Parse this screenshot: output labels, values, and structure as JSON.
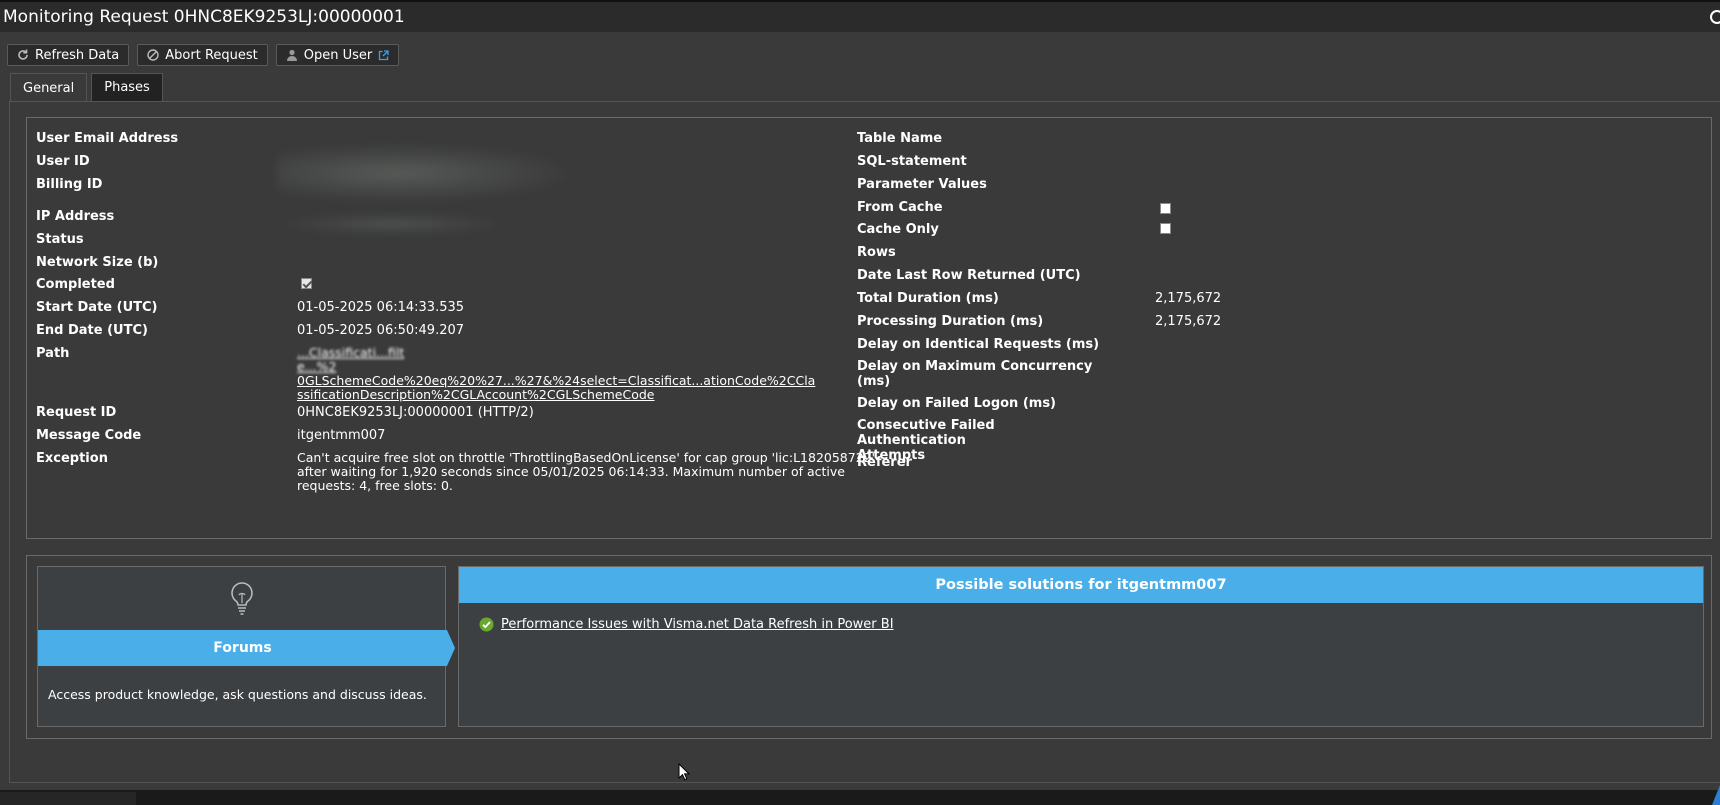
{
  "window": {
    "title": "Monitoring Request 0HNC8EK9253LJ:00000001"
  },
  "toolbar": {
    "refresh_label": "Refresh Data",
    "abort_label": "Abort Request",
    "open_user_label": "Open User"
  },
  "tabs": [
    {
      "label": "General",
      "active": true
    },
    {
      "label": "Phases",
      "active": false
    }
  ],
  "left_fields": {
    "user_email": {
      "label": "User Email Address",
      "value": ""
    },
    "user_id": {
      "label": "User ID",
      "value": ""
    },
    "billing_id": {
      "label": "Billing ID",
      "value": ""
    },
    "ip_address": {
      "label": "IP Address",
      "value": ""
    },
    "status": {
      "label": "Status",
      "value": ""
    },
    "network_size": {
      "label": "Network Size (b)",
      "value": ""
    },
    "completed": {
      "label": "Completed",
      "checked": true
    },
    "start_date": {
      "label": "Start Date (UTC)",
      "value": "01-05-2025 06:14:33.535"
    },
    "end_date": {
      "label": "End Date (UTC)",
      "value": "01-05-2025 06:50:49.207"
    },
    "path": {
      "label": "Path",
      "value_line1": "...Classificati...filt",
      "value_line2": "e...%2",
      "value_line3": "0GLSchemeCode%20eq%20%27...%27&%24select=Classificat...ationCode%2CCla",
      "value_line4": "ssificationDescription%2CGLAccount%2CGLSchemeCode"
    },
    "request_id": {
      "label": "Request ID",
      "value": "0HNC8EK9253LJ:00000001 (HTTP/2)"
    },
    "message_code": {
      "label": "Message Code",
      "value": "itgentmm007"
    },
    "exception": {
      "label": "Exception",
      "line1": "Can't acquire free slot on throttle 'ThrottlingBasedOnLicense' for cap group 'lic:L182058722'",
      "line2": "after waiting for 1,920 seconds since 05/01/2025 06:14:33. Maximum number of active",
      "line3": "requests: 4, free slots: 0."
    }
  },
  "right_fields": {
    "table_name": {
      "label": "Table Name"
    },
    "sql_statement": {
      "label": "SQL-statement"
    },
    "parameter_values": {
      "label": "Parameter Values"
    },
    "from_cache": {
      "label": "From Cache",
      "checked": false
    },
    "cache_only": {
      "label": "Cache Only",
      "checked": false
    },
    "rows": {
      "label": "Rows"
    },
    "date_last_row": {
      "label": "Date Last Row Returned (UTC)"
    },
    "total_duration": {
      "label": "Total Duration (ms)",
      "value": "2,175,672"
    },
    "processing_duration": {
      "label": "Processing Duration (ms)",
      "value": "2,175,672"
    },
    "delay_identical": {
      "label": "Delay on Identical Requests (ms)"
    },
    "delay_max_concurrency": {
      "label_line1": "Delay on Maximum Concurrency",
      "label_line2": "(ms)"
    },
    "delay_failed_logon": {
      "label": "Delay on Failed Logon (ms)"
    },
    "consecutive_failed": {
      "label_line1": "Consecutive Failed Authentication",
      "label_line2": "Attempts"
    },
    "referer": {
      "label": "Referer"
    }
  },
  "forums": {
    "title": "Forums",
    "description": "Access product knowledge, ask questions and discuss ideas."
  },
  "solutions": {
    "header": "Possible solutions for itgentmm007",
    "items": [
      {
        "label": "Performance Issues with Visma.net Data Refresh in Power BI"
      }
    ]
  },
  "colors": {
    "accent": "#4aaee8",
    "panel": "#3a3a3a",
    "check_green": "#6aa82d"
  }
}
